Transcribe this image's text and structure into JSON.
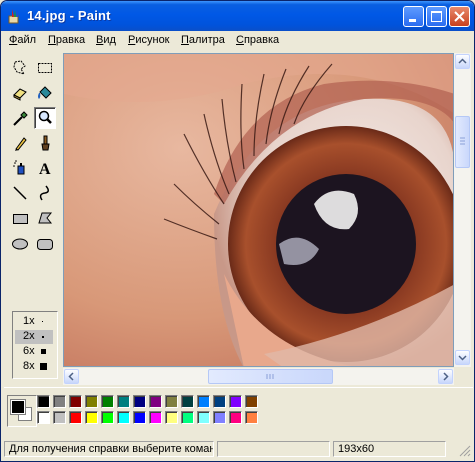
{
  "window": {
    "title": "14.jpg - Paint"
  },
  "menu": [
    {
      "label": "Файл",
      "accel": "Ф",
      "rest": "айл"
    },
    {
      "label": "Правка",
      "accel": "П",
      "rest": "равка"
    },
    {
      "label": "Вид",
      "accel": "В",
      "rest": "ид"
    },
    {
      "label": "Рисунок",
      "accel": "Р",
      "rest": "исунок"
    },
    {
      "label": "Палитра",
      "accel": "П",
      "rest": "алитра"
    },
    {
      "label": "Справка",
      "accel": "С",
      "rest": "правка"
    }
  ],
  "tools": [
    {
      "name": "free-form-select-icon"
    },
    {
      "name": "rectangle-select-icon"
    },
    {
      "name": "eraser-icon"
    },
    {
      "name": "fill-bucket-icon"
    },
    {
      "name": "color-picker-icon"
    },
    {
      "name": "magnifier-icon",
      "selected": true
    },
    {
      "name": "pencil-icon"
    },
    {
      "name": "brush-icon"
    },
    {
      "name": "airbrush-icon"
    },
    {
      "name": "text-icon"
    },
    {
      "name": "line-icon"
    },
    {
      "name": "curve-icon"
    },
    {
      "name": "rectangle-icon"
    },
    {
      "name": "polygon-icon"
    },
    {
      "name": "ellipse-icon"
    },
    {
      "name": "rounded-rectangle-icon"
    }
  ],
  "zoom_options": [
    {
      "label": "1x"
    },
    {
      "label": "2x",
      "selected": true
    },
    {
      "label": "6x"
    },
    {
      "label": "8x"
    }
  ],
  "colors": {
    "foreground": "#000000",
    "background": "#ffffff",
    "row1": [
      "#000000",
      "#808080",
      "#800000",
      "#808000",
      "#008000",
      "#008080",
      "#000080",
      "#800080",
      "#808040",
      "#004040",
      "#0080ff",
      "#004080",
      "#8000ff",
      "#804000"
    ],
    "row2": [
      "#ffffff",
      "#c0c0c0",
      "#ff0000",
      "#ffff00",
      "#00ff00",
      "#00ffff",
      "#0000ff",
      "#ff00ff",
      "#ffff80",
      "#00ff80",
      "#80ffff",
      "#8080ff",
      "#ff0080",
      "#ff8040"
    ]
  },
  "status": {
    "help_text": "Для получения справки выберите коман",
    "coords": "",
    "size": "193x60"
  }
}
